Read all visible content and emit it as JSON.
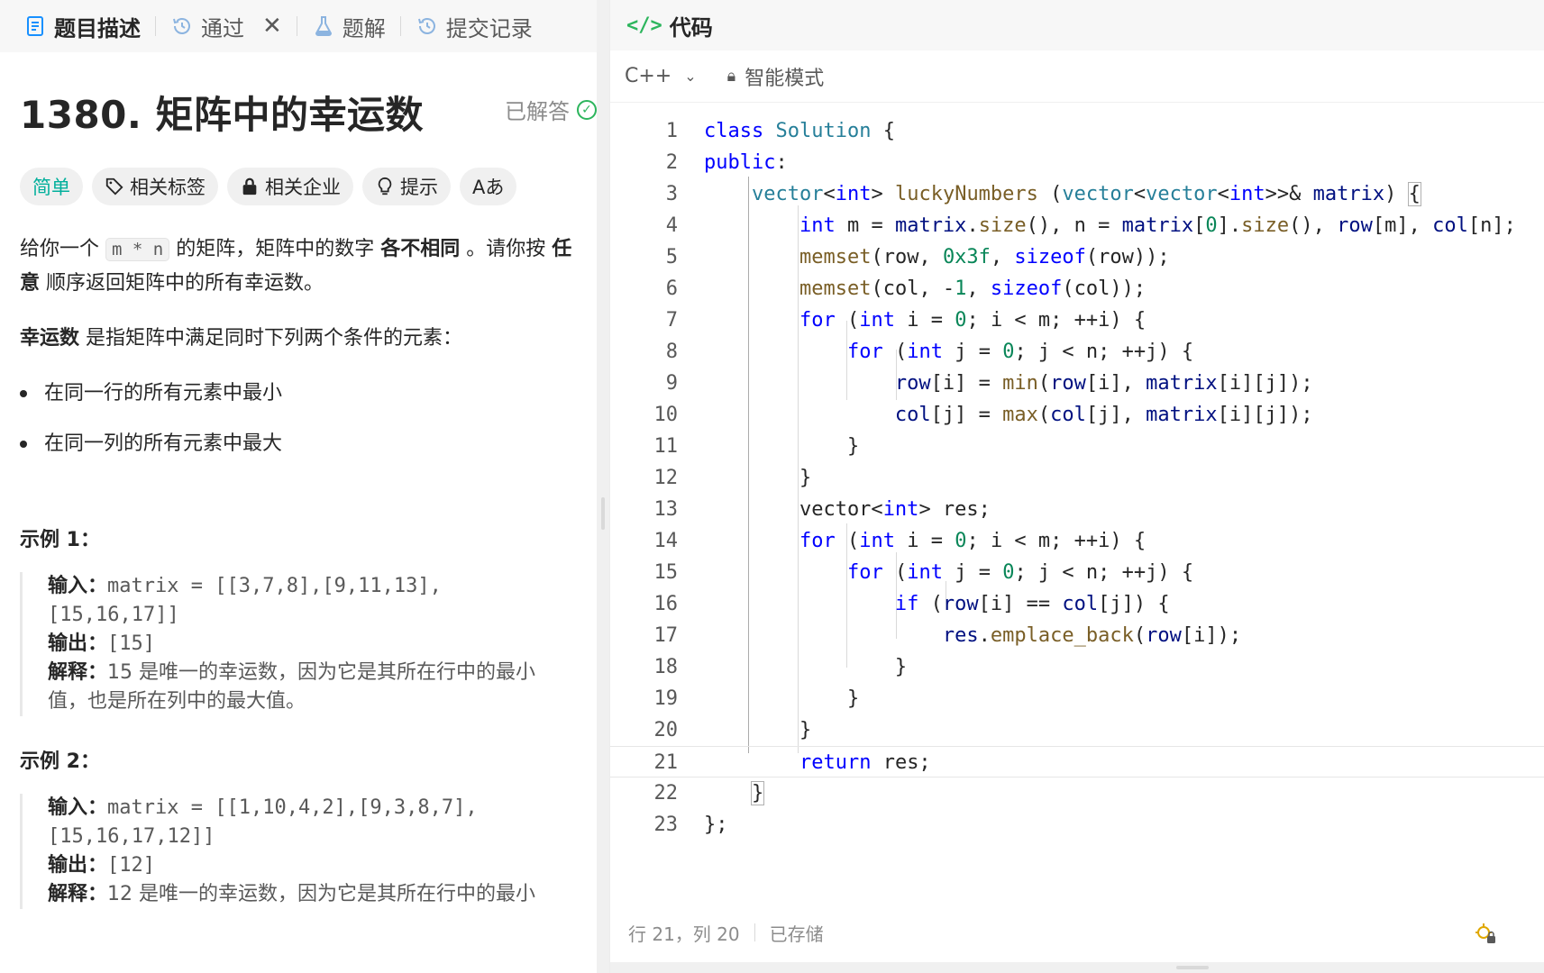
{
  "tabs": [
    {
      "label": "题目描述",
      "icon": "document-icon",
      "active": true
    },
    {
      "label": "通过",
      "icon": "history-icon",
      "closable": true
    },
    {
      "label": "题解",
      "icon": "flask-icon"
    },
    {
      "label": "提交记录",
      "icon": "history-icon"
    }
  ],
  "problem": {
    "title": "1380. 矩阵中的幸运数",
    "status": "已解答",
    "tags": [
      "简单",
      "相关标签",
      "相关企业",
      "提示",
      "Aあ"
    ],
    "desc_p1_a": "给你一个 ",
    "desc_p1_code": "m * n",
    "desc_p1_b": " 的矩阵，矩阵中的数字 ",
    "desc_p1_bold1": "各不相同",
    "desc_p1_c": " 。请你按 ",
    "desc_p1_bold2": "任意",
    "desc_p1_d": " 顺序返回矩阵中的所有幸运数。",
    "desc_p2_bold": "幸运数",
    "desc_p2_rest": " 是指矩阵中满足同时下列两个条件的元素：",
    "bullets": [
      "在同一行的所有元素中最小",
      "在同一列的所有元素中最大"
    ],
    "examples": [
      {
        "title": "示例 1：",
        "input_label": "输入：",
        "input_line1": "matrix = [[3,7,8],[9,11,13],",
        "input_line2": "[15,16,17]]",
        "output_label": "输出：",
        "output": "[15]",
        "explain_label": "解释：",
        "explain_line1": "15 是唯一的幸运数，因为它是其所在行中的最小",
        "explain_line2": "值，也是所在列中的最大值。"
      },
      {
        "title": "示例 2：",
        "input_label": "输入：",
        "input_line1": "matrix = [[1,10,4,2],[9,3,8,7],",
        "input_line2": "[15,16,17,12]]",
        "output_label": "输出：",
        "output": "[12]",
        "explain_label": "解释：",
        "explain_line1": "12 是唯一的幸运数，因为它是其所在行中的最小"
      }
    ]
  },
  "editor": {
    "header": "代码",
    "language": "C++",
    "mode": "智能模式",
    "cursor": "行 21，列 20",
    "saved": "已存储",
    "line_numbers": [
      "1",
      "2",
      "3",
      "4",
      "5",
      "6",
      "7",
      "8",
      "9",
      "10",
      "11",
      "12",
      "13",
      "14",
      "15",
      "16",
      "17",
      "18",
      "19",
      "20",
      "21",
      "22",
      "23"
    ]
  },
  "colors": {
    "accent_green": "#2db55d",
    "easy": "#00af9b",
    "keyword": "#0000ff"
  }
}
